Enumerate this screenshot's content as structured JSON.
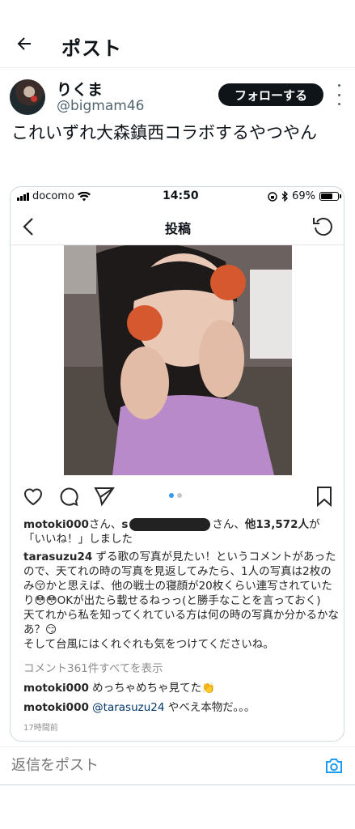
{
  "header": {
    "title": "ポスト"
  },
  "author": {
    "display_name": "りくま",
    "handle": "@bigmam46",
    "follow_label": "フォローする"
  },
  "tweet": {
    "text": "これいずれ大森鎮西コラボするやつやん"
  },
  "embedded_screenshot": {
    "status_bar": {
      "carrier": "docomo",
      "time": "14:50",
      "battery": "69%",
      "battery_level": 0.69
    },
    "instagram": {
      "nav_title": "投稿",
      "carousel": {
        "active": 1,
        "count": 2
      },
      "likes": {
        "user1": "motoki000",
        "suffix1": "さん、",
        "user2_prefix": "s",
        "suffix2": "さん、",
        "count_text": "他13,572人",
        "tail": "が「いいね！」しました"
      },
      "caption": {
        "user": "tarasuzu24",
        "text": " ずる歌の写真が見たい！というコメントがあったので、天てれの時の写真を見返してみたら、1人の写真は2枚のみ😚かと思えば、他の戦士の寝顔が20枚くらい連写されていたり😳😳OKが出たら載せるねっっ(と勝手なことを言っておく)",
        "line2": "天てれから私を知ってくれている方は何の時の写真か分かるかなあ？😏",
        "line3": "そして台風にはくれぐれも気をつけてくださいね。"
      },
      "view_all_comments": "コメント361件すべてを表示",
      "comments": [
        {
          "user": "motoki000",
          "text": " めっちゃめちゃ見てた👏"
        },
        {
          "user": "motoki000",
          "mention": "@tarasuzu24",
          "text": " やべえ本物だ。。。"
        }
      ],
      "timestamp": "17時間前"
    }
  },
  "reply": {
    "placeholder": "返信をポスト"
  },
  "colors": {
    "accent": "#1d9bf0",
    "text": "#0f1419",
    "muted": "#536471",
    "follow_bg": "#0f1419"
  },
  "icons": [
    "back-arrow-icon",
    "more-icon",
    "signal-icon",
    "wifi-icon",
    "lock-rotation-icon",
    "bluetooth-icon",
    "battery-icon",
    "chevron-left-icon",
    "refresh-icon",
    "heart-icon",
    "comment-icon",
    "share-icon",
    "bookmark-icon",
    "camera-icon"
  ]
}
